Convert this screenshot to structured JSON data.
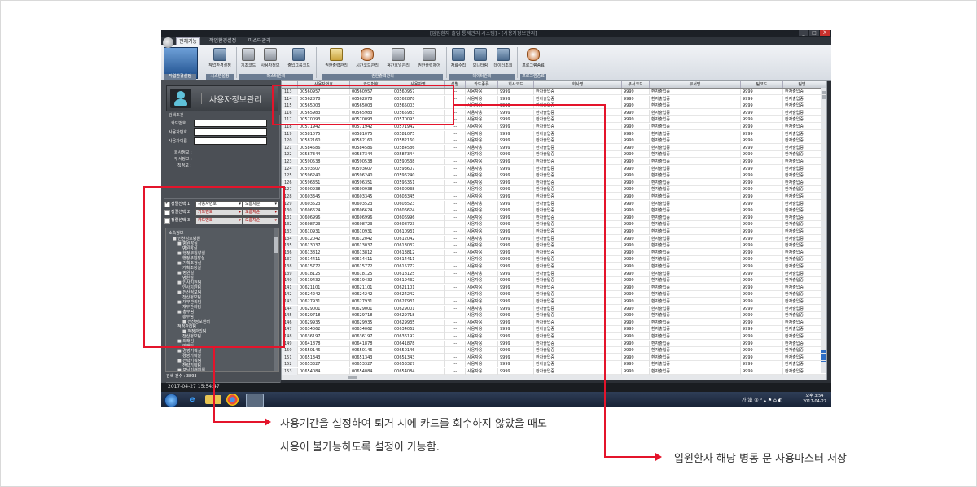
{
  "window": {
    "title": "[입원환자 출입 통제관리 시스템] - [사용자정보관리]",
    "controls": [
      "_",
      "□",
      "X"
    ]
  },
  "ribbon": {
    "tabs": [
      "전체기능",
      "작업환경설정",
      "마스터관리"
    ],
    "buttons": [
      "작업환경설정",
      "기초코드",
      "사용자정보",
      "출입그룹코드",
      "권한출력관리",
      "시간코드관리",
      "휴간호일관리",
      "권한출력제어",
      "자료수집",
      "모니터링",
      "데이터조회",
      "프로그램종료"
    ],
    "groups": [
      "작업환경설정",
      "시스템설정",
      "마스터관리",
      "권한출력관리",
      "데이터관리",
      "프로그램종료"
    ]
  },
  "left_panel": {
    "title": "사용자정보관리",
    "search_caption": "검색조건",
    "fields": [
      "카드번호",
      "사용자번호",
      "사용자이름",
      "회사정보 :",
      "부서정보 :",
      "직정보 :"
    ],
    "sort_rows": [
      {
        "checked": true,
        "label": "정렬선택 1",
        "field": "사용자번호",
        "order": "오름차순"
      },
      {
        "checked": false,
        "label": "정렬선택 2",
        "field": "카드번호",
        "order": "오름차순"
      },
      {
        "checked": false,
        "label": "정렬선택 3",
        "field": "카드번호",
        "order": "오름차순"
      }
    ],
    "tree_root": "소속정보",
    "tree": [
      "인천성모병원",
      "병원장실",
      "병원장실",
      "행정부원장실",
      "행정부원장실",
      "기획조정실",
      "기획조정실",
      "병원실",
      "병원실",
      "인사지원팀",
      "인사지원팀",
      "전산정보팀",
      "전산정보팀",
      "재무관리팀",
      "재무관리팀",
      "총무팀",
      "총무팀",
      "전산정보센터",
      "적정관리팀",
      "적정관리팀",
      "전산정보팀",
      "외래팀",
      "외래팀",
      "경영기획실",
      "경영기획실",
      "전략기획팀",
      "전략기획팀",
      "포닝미래위원"
    ],
    "count_label": "검색 건수 : 3893",
    "buttons": [
      "전체",
      "검색",
      "엑셀",
      "신규",
      "삭제",
      "종료"
    ]
  },
  "grid": {
    "headers": [
      "",
      "사용자번호",
      "카드번호",
      "사용자명",
      "성별",
      "카드종류",
      "회사코드",
      "회사명",
      "부서코드",
      "부서명",
      "팀코드",
      "팀명"
    ],
    "rows": [
      [
        "113",
        "00560957",
        "00560957",
        "00560957",
        "---",
        "사용자용",
        "9999",
        "환자출입증",
        "9999",
        "환자출입증",
        "9999",
        "환자출입증"
      ],
      [
        "114",
        "00562878",
        "00562878",
        "00562878",
        "---",
        "사용자용",
        "9999",
        "환자출입증",
        "9999",
        "환자출입증",
        "9999",
        "환자출입증"
      ],
      [
        "115",
        "00565003",
        "00565003",
        "00565003",
        "---",
        "사용자용",
        "9999",
        "환자출입증",
        "9999",
        "환자출입증",
        "9999",
        "환자출입증"
      ],
      [
        "116",
        "00565983",
        "00565983",
        "00565983",
        "---",
        "사용자용",
        "9999",
        "환자출입증",
        "9999",
        "환자출입증",
        "9999",
        "환자출입증"
      ],
      [
        "117",
        "00570093",
        "00570093",
        "00570093",
        "---",
        "사용자용",
        "9999",
        "환자출입증",
        "9999",
        "환자출입증",
        "9999",
        "환자출입증"
      ],
      [
        "118",
        "00571942",
        "00571942",
        "00571942",
        "---",
        "사용자용",
        "9999",
        "환자출입증",
        "9999",
        "환자출입증",
        "9999",
        "환자출입증"
      ],
      [
        "119",
        "00581075",
        "00581075",
        "00581075",
        "---",
        "사용자용",
        "9999",
        "환자출입증",
        "9999",
        "환자출입증",
        "9999",
        "환자출입증"
      ],
      [
        "120",
        "00582160",
        "00582160",
        "00582160",
        "---",
        "사용자용",
        "9999",
        "환자출입증",
        "9999",
        "환자출입증",
        "9999",
        "환자출입증"
      ],
      [
        "121",
        "00584586",
        "00584586",
        "00584586",
        "---",
        "사용자용",
        "9999",
        "환자출입증",
        "9999",
        "환자출입증",
        "9999",
        "환자출입증"
      ],
      [
        "122",
        "00587344",
        "00587344",
        "00587344",
        "---",
        "사용자용",
        "9999",
        "환자출입증",
        "9999",
        "환자출입증",
        "9999",
        "환자출입증"
      ],
      [
        "123",
        "00590538",
        "00590538",
        "00590538",
        "---",
        "사용자용",
        "9999",
        "환자출입증",
        "9999",
        "환자출입증",
        "9999",
        "환자출입증"
      ],
      [
        "124",
        "00593607",
        "00593607",
        "00593607",
        "---",
        "사용자용",
        "9999",
        "환자출입증",
        "9999",
        "환자출입증",
        "9999",
        "환자출입증"
      ],
      [
        "125",
        "00596240",
        "00596240",
        "00596240",
        "---",
        "사용자용",
        "9999",
        "환자출입증",
        "9999",
        "환자출입증",
        "9999",
        "환자출입증"
      ],
      [
        "126",
        "00596351",
        "00596351",
        "00596351",
        "---",
        "사용자용",
        "9999",
        "환자출입증",
        "9999",
        "환자출입증",
        "9999",
        "환자출입증"
      ],
      [
        "127",
        "00600938",
        "00600938",
        "00600938",
        "---",
        "사용자용",
        "9999",
        "환자출입증",
        "9999",
        "환자출입증",
        "9999",
        "환자출입증"
      ],
      [
        "128",
        "00603345",
        "00603345",
        "00603345",
        "---",
        "사용자용",
        "9999",
        "환자출입증",
        "9999",
        "환자출입증",
        "9999",
        "환자출입증"
      ],
      [
        "129",
        "00603523",
        "00603523",
        "00603523",
        "---",
        "사용자용",
        "9999",
        "환자출입증",
        "9999",
        "환자출입증",
        "9999",
        "환자출입증"
      ],
      [
        "130",
        "00606624",
        "00606624",
        "00606624",
        "---",
        "사용자용",
        "9999",
        "환자출입증",
        "9999",
        "환자출입증",
        "9999",
        "환자출입증"
      ],
      [
        "131",
        "00606996",
        "00606996",
        "00606996",
        "---",
        "사용자용",
        "9999",
        "환자출입증",
        "9999",
        "환자출입증",
        "9999",
        "환자출입증"
      ],
      [
        "132",
        "00608723",
        "00608723",
        "00608723",
        "---",
        "사용자용",
        "9999",
        "환자출입증",
        "9999",
        "환자출입증",
        "9999",
        "환자출입증"
      ],
      [
        "133",
        "00610931",
        "00610931",
        "00610931",
        "---",
        "사용자용",
        "9999",
        "환자출입증",
        "9999",
        "환자출입증",
        "9999",
        "환자출입증"
      ],
      [
        "134",
        "00612042",
        "00612042",
        "00612042",
        "---",
        "사용자용",
        "9999",
        "환자출입증",
        "9999",
        "환자출입증",
        "9999",
        "환자출입증"
      ],
      [
        "135",
        "00613037",
        "00613037",
        "00613037",
        "---",
        "사용자용",
        "9999",
        "환자출입증",
        "9999",
        "환자출입증",
        "9999",
        "환자출입증"
      ],
      [
        "136",
        "00613812",
        "00613812",
        "00613812",
        "---",
        "사용자용",
        "9999",
        "환자출입증",
        "9999",
        "환자출입증",
        "9999",
        "환자출입증"
      ],
      [
        "137",
        "00614411",
        "00614411",
        "00614411",
        "---",
        "사용자용",
        "9999",
        "환자출입증",
        "9999",
        "환자출입증",
        "9999",
        "환자출입증"
      ],
      [
        "138",
        "00615772",
        "00615772",
        "00615772",
        "---",
        "사용자용",
        "9999",
        "환자출입증",
        "9999",
        "환자출입증",
        "9999",
        "환자출입증"
      ],
      [
        "139",
        "00618125",
        "00618125",
        "00618125",
        "---",
        "사용자용",
        "9999",
        "환자출입증",
        "9999",
        "환자출입증",
        "9999",
        "환자출입증"
      ],
      [
        "140",
        "00619432",
        "00619432",
        "00619432",
        "---",
        "사용자용",
        "9999",
        "환자출입증",
        "9999",
        "환자출입증",
        "9999",
        "환자출입증"
      ],
      [
        "141",
        "00621101",
        "00621101",
        "00621101",
        "---",
        "사용자용",
        "9999",
        "환자출입증",
        "9999",
        "환자출입증",
        "9999",
        "환자출입증"
      ],
      [
        "142",
        "00624242",
        "00624242",
        "00624242",
        "---",
        "사용자용",
        "9999",
        "환자출입증",
        "9999",
        "환자출입증",
        "9999",
        "환자출입증"
      ],
      [
        "143",
        "00627931",
        "00627931",
        "00627931",
        "---",
        "사용자용",
        "9999",
        "환자출입증",
        "9999",
        "환자출입증",
        "9999",
        "환자출입증"
      ],
      [
        "144",
        "00629001",
        "00629001",
        "00629001",
        "---",
        "사용자용",
        "9999",
        "환자출입증",
        "9999",
        "환자출입증",
        "9999",
        "환자출입증"
      ],
      [
        "145",
        "00629718",
        "00629718",
        "00629718",
        "---",
        "사용자용",
        "9999",
        "환자출입증",
        "9999",
        "환자출입증",
        "9999",
        "환자출입증"
      ],
      [
        "146",
        "00629935",
        "00629935",
        "00629935",
        "---",
        "사용자용",
        "9999",
        "환자출입증",
        "9999",
        "환자출입증",
        "9999",
        "환자출입증"
      ],
      [
        "147",
        "00634062",
        "00634062",
        "00634062",
        "---",
        "사용자용",
        "9999",
        "환자출입증",
        "9999",
        "환자출입증",
        "9999",
        "환자출입증"
      ],
      [
        "148",
        "00636197",
        "00636197",
        "00636197",
        "---",
        "사용자용",
        "9999",
        "환자출입증",
        "9999",
        "환자출입증",
        "9999",
        "환자출입증"
      ],
      [
        "149",
        "00641878",
        "00641878",
        "00641878",
        "---",
        "사용자용",
        "9999",
        "환자출입증",
        "9999",
        "환자출입증",
        "9999",
        "환자출입증"
      ],
      [
        "150",
        "00650146",
        "00650146",
        "00650146",
        "---",
        "사용자용",
        "9999",
        "환자출입증",
        "9999",
        "환자출입증",
        "9999",
        "환자출입증"
      ],
      [
        "151",
        "00651343",
        "00651343",
        "00651343",
        "---",
        "사용자용",
        "9999",
        "환자출입증",
        "9999",
        "환자출입증",
        "9999",
        "환자출입증"
      ],
      [
        "152",
        "00653327",
        "00653327",
        "00653327",
        "---",
        "사용자용",
        "9999",
        "환자출입증",
        "9999",
        "환자출입증",
        "9999",
        "환자출입증"
      ],
      [
        "153",
        "00654084",
        "00654084",
        "00654084",
        "---",
        "사용자용",
        "9999",
        "환자출입증",
        "9999",
        "환자출입증",
        "9999",
        "환자출입증"
      ]
    ]
  },
  "statusbar": {
    "text": "2017-04-27 15:54:47"
  },
  "taskbar": {
    "tray": "가 漢 ② ⁰ ▴ ⚑ ⌂ ◐",
    "clock_time": "오후 3:54",
    "clock_date": "2017-04-27"
  },
  "annotations": {
    "left_note_line1": "사용기간을 설정하여 퇴거 시에 카드를 회수하지 않았을 때도",
    "left_note_line2": "사용이 불가능하도록 설정이 가능함.",
    "right_note": "입원환자 해당 병동 문 사용마스터 저장",
    "accent_color": "#e4142b"
  }
}
